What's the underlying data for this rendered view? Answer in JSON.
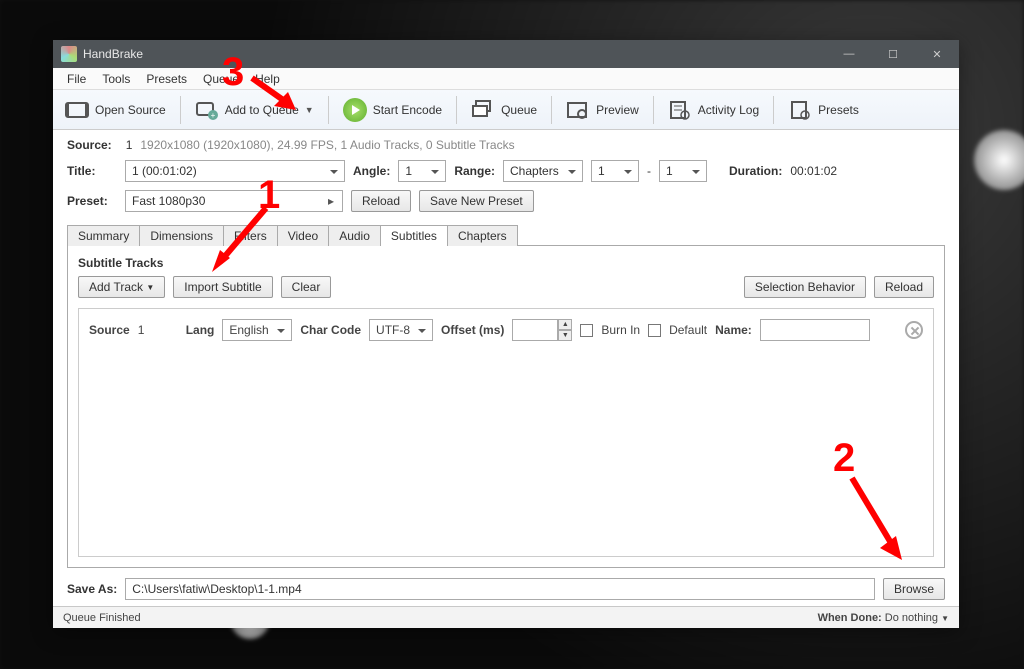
{
  "app": {
    "title": "HandBrake"
  },
  "menu": {
    "file": "File",
    "tools": "Tools",
    "presets": "Presets",
    "queue": "Queue",
    "help": "Help"
  },
  "toolbar": {
    "open_source": "Open Source",
    "add_to_queue": "Add to Queue",
    "start_encode": "Start Encode",
    "queue": "Queue",
    "preview": "Preview",
    "activity_log": "Activity Log",
    "presets": "Presets"
  },
  "source": {
    "label": "Source:",
    "index": "1",
    "meta": "1920x1080 (1920x1080), 24.99 FPS, 1 Audio Tracks, 0 Subtitle Tracks"
  },
  "title_row": {
    "title_label": "Title:",
    "title_value": "1  (00:01:02)",
    "angle_label": "Angle:",
    "angle_value": "1",
    "range_label": "Range:",
    "range_mode": "Chapters",
    "range_from": "1",
    "range_sep": "-",
    "range_to": "1",
    "duration_label": "Duration:",
    "duration_value": "00:01:02"
  },
  "preset_row": {
    "preset_label": "Preset:",
    "preset_value": "Fast 1080p30",
    "reload": "Reload",
    "save_new": "Save New Preset"
  },
  "tabs": {
    "summary": "Summary",
    "dimensions": "Dimensions",
    "filters": "Filters",
    "video": "Video",
    "audio": "Audio",
    "subtitles": "Subtitles",
    "chapters": "Chapters"
  },
  "subs": {
    "header": "Subtitle Tracks",
    "add_track": "Add Track",
    "import": "Import Subtitle",
    "clear": "Clear",
    "selection_behavior": "Selection Behavior",
    "reload": "Reload",
    "track": {
      "source_lbl": "Source",
      "source_val": "1",
      "lang_lbl": "Lang",
      "lang_val": "English",
      "charcode_lbl": "Char Code",
      "charcode_val": "UTF-8",
      "offset_lbl": "Offset (ms)",
      "offset_val": "",
      "burnin": "Burn In",
      "default": "Default",
      "name_lbl": "Name:",
      "name_val": ""
    }
  },
  "saveas": {
    "label": "Save As:",
    "path": "C:\\Users\\fatiw\\Desktop\\1-1.mp4",
    "browse": "Browse"
  },
  "status": {
    "left": "Queue Finished",
    "when_done_lbl": "When Done:",
    "when_done_val": "Do nothing"
  },
  "annotations": {
    "n1": "1",
    "n2": "2",
    "n3": "3"
  }
}
